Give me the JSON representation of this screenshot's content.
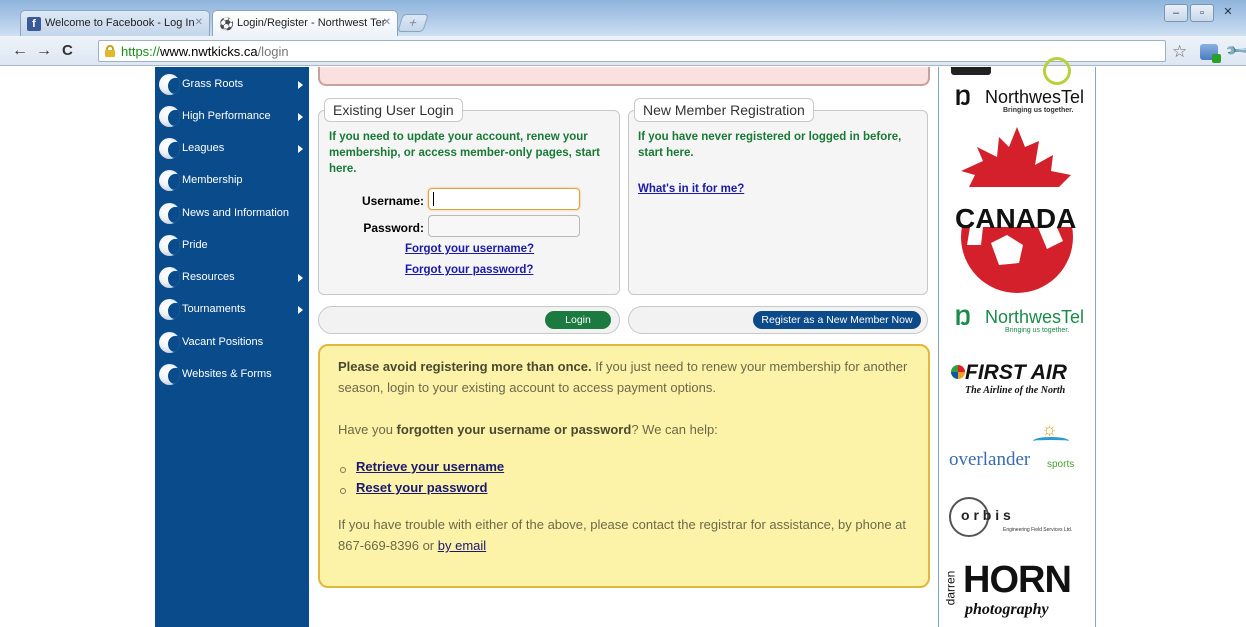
{
  "browser": {
    "tabs": [
      {
        "title": "Welcome to Facebook - Log In",
        "icon": "facebook-icon",
        "active": false
      },
      {
        "title": "Login/Register - Northwest Ter",
        "icon": "soccer-ball-icon",
        "active": true
      }
    ],
    "url": {
      "scheme": "https://",
      "host": "www.nwtkicks.ca",
      "path": "/login"
    }
  },
  "sidebar": {
    "items": [
      {
        "label": "Grass Roots",
        "has_submenu": true
      },
      {
        "label": "High Performance",
        "has_submenu": true
      },
      {
        "label": "Leagues",
        "has_submenu": true
      },
      {
        "label": "Membership",
        "has_submenu": false
      },
      {
        "label": "News and Information",
        "has_submenu": false
      },
      {
        "label": "Pride",
        "has_submenu": false
      },
      {
        "label": "Resources",
        "has_submenu": true
      },
      {
        "label": "Tournaments",
        "has_submenu": true
      },
      {
        "label": "Vacant Positions",
        "has_submenu": false
      },
      {
        "label": "Websites & Forms",
        "has_submenu": false
      }
    ]
  },
  "login": {
    "legend": "Existing User Login",
    "description": "If you need to update your account, renew your membership, or access member-only pages, start here.",
    "username_label": "Username:",
    "username_value": "",
    "password_label": "Password:",
    "password_value": "",
    "forgot_username": "Forgot your username?",
    "forgot_password": "Forgot your password?",
    "button": "Login"
  },
  "register": {
    "legend": "New Member Registration",
    "description": "If you have never registered or logged in before, start here.",
    "whats_in_it": "What's in it for me?",
    "button": "Register as a New Member Now"
  },
  "notice": {
    "p1_bold": "Please avoid registering more than once.",
    "p1_rest": " If you just need to renew your membership for another season, login to your existing account to access payment options.",
    "p2_pre": "Have you ",
    "p2_bold": "forgotten your username or password",
    "p2_post": "? We can help:",
    "links": [
      "Retrieve your username",
      "Reset your password"
    ],
    "p3": "If you have trouble with either of the above, please contact the registrar for assistance, by phone at 867-669-8396 or ",
    "p3_link": "by email"
  },
  "sponsors": {
    "northwestel": {
      "name": "NorthwesTel",
      "tagline": "Bringing us together."
    },
    "canada": {
      "name": "CANADA"
    },
    "first_air": {
      "name": "FIRST AIR",
      "tagline": "The Airline of the North"
    },
    "overlander": {
      "name": "overlander",
      "sub": "sports"
    },
    "orbis": {
      "name": "o r b i s",
      "tagline": "Engineering Field Services Ltd."
    },
    "horn": {
      "name": "HORN",
      "first": "darren",
      "sub": "photography"
    }
  },
  "colors": {
    "sidebar": "#0a4b8c",
    "login_button": "#1a7a40",
    "register_button": "#0d4a8a",
    "panel_text": "#197a35",
    "notice_bg": "#fcf2a8"
  }
}
